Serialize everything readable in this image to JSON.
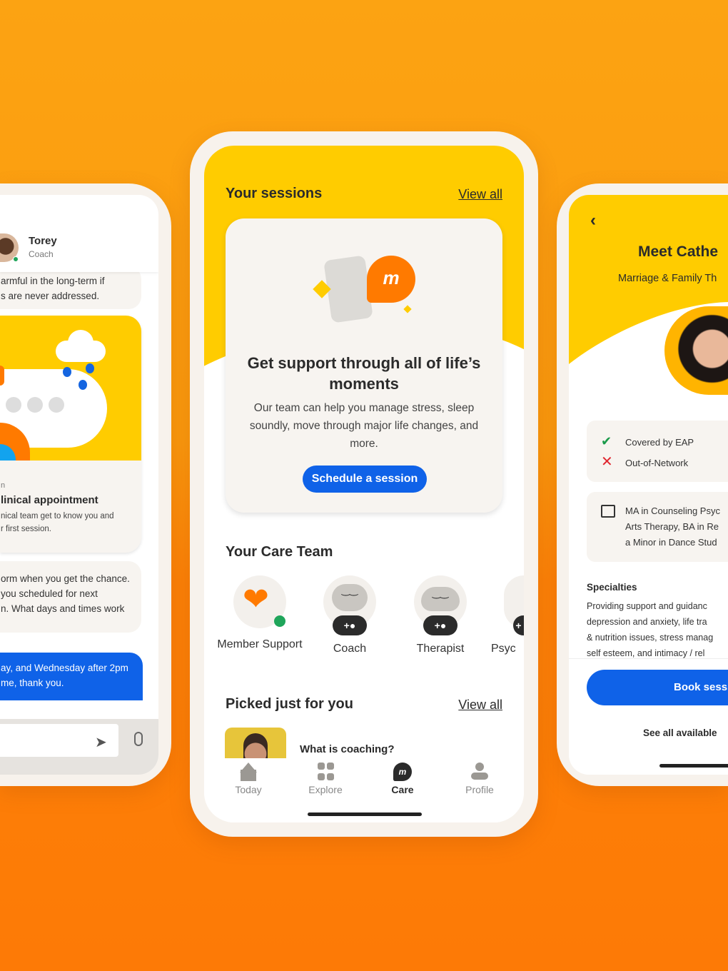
{
  "colors": {
    "accent_blue": "#0f62e8",
    "yellow": "#ffcc00",
    "orange": "#ff7a00",
    "online_green": "#1fa55a"
  },
  "left_phone": {
    "contact_name": "Torey",
    "contact_role": "Coach",
    "message_1": [
      "armful in the long-term if",
      "s are never addressed."
    ],
    "card_eyebrow": "n",
    "card_title": "linical appointment",
    "card_desc": [
      "nical team get to know you and",
      "r first session."
    ],
    "message_2": [
      "orm when you get the chance.",
      " you scheduled for next",
      "n. What days and times work"
    ],
    "reply": [
      "ay, and Wednesday after 2pm",
      "me, thank you."
    ],
    "icons": [
      "send-icon",
      "microphone-icon"
    ]
  },
  "center_phone": {
    "sessions_title": "Your sessions",
    "sessions_view_all": "View all",
    "card_title": "Get support through all of life’s moments",
    "card_desc": "Our team can help you manage stress, sleep soundly, move through major life changes, and more.",
    "schedule_button": "Schedule a session",
    "care_team_title": "Your Care Team",
    "care_team": [
      {
        "label": "Member Support",
        "online": true
      },
      {
        "label": "Coach"
      },
      {
        "label": "Therapist"
      },
      {
        "label": "Psyc"
      }
    ],
    "picked_title": "Picked just for you",
    "picked_view_all": "View all",
    "picked_item": "What is coaching?",
    "nav": [
      {
        "label": "Today",
        "icon": "home-icon"
      },
      {
        "label": "Explore",
        "icon": "grid-icon"
      },
      {
        "label": "Care",
        "icon": "chat-icon",
        "active": true
      },
      {
        "label": "Profile",
        "icon": "person-icon"
      }
    ]
  },
  "right_phone": {
    "title": "Meet Cathe",
    "subtitle": "Marriage & Family Th",
    "covered": "Covered by EAP",
    "out_network": "Out-of-Network",
    "education": [
      "MA in Counseling Psyc",
      "Arts Therapy, BA in Re",
      "a Minor in Dance Stud"
    ],
    "specialties_title": "Specialties",
    "specialties": [
      "Providing support and guidanc",
      "depression and anxiety, life tra",
      "& nutrition issues, stress manag",
      "self esteem, and intimacy / rel"
    ],
    "book_button": "Book sessi",
    "see_all": "See all available"
  }
}
